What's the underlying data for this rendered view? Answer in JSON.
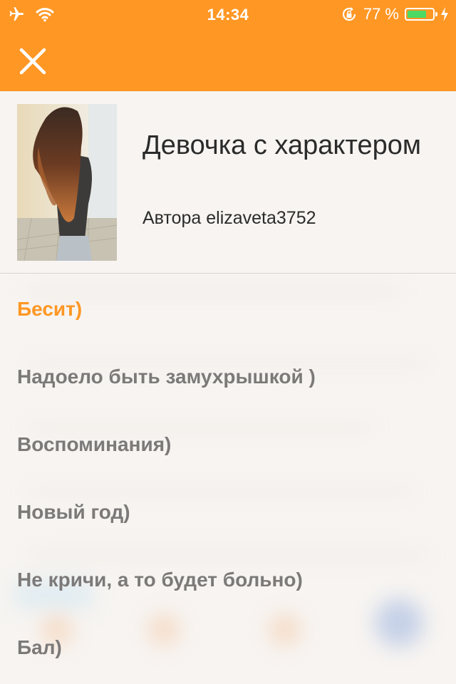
{
  "status_bar": {
    "time": "14:34",
    "battery_text": "77 %",
    "battery_level": 0.77,
    "icons": [
      "airplane-icon",
      "wifi-icon",
      "rotation-lock-icon",
      "battery-icon",
      "charging-icon"
    ]
  },
  "header": {
    "close_icon": "close-icon"
  },
  "story": {
    "title": "Девочка с характером",
    "author": "Автора elizaveta3752"
  },
  "chapters": [
    {
      "label": "Бесит)",
      "active": true
    },
    {
      "label": "Надоело быть замухрышкой )",
      "active": false
    },
    {
      "label": "Воспоминания)",
      "active": false
    },
    {
      "label": "Новый год)",
      "active": false
    },
    {
      "label": "Не кричи, а то будет больно)",
      "active": false
    },
    {
      "label": "Бал)",
      "active": false
    }
  ],
  "colors": {
    "accent": "#ff9724",
    "chapter_text": "#7c7a79",
    "title_text": "#2b2b2b",
    "background": "#f7f4f1",
    "battery_green": "#4cd964"
  }
}
